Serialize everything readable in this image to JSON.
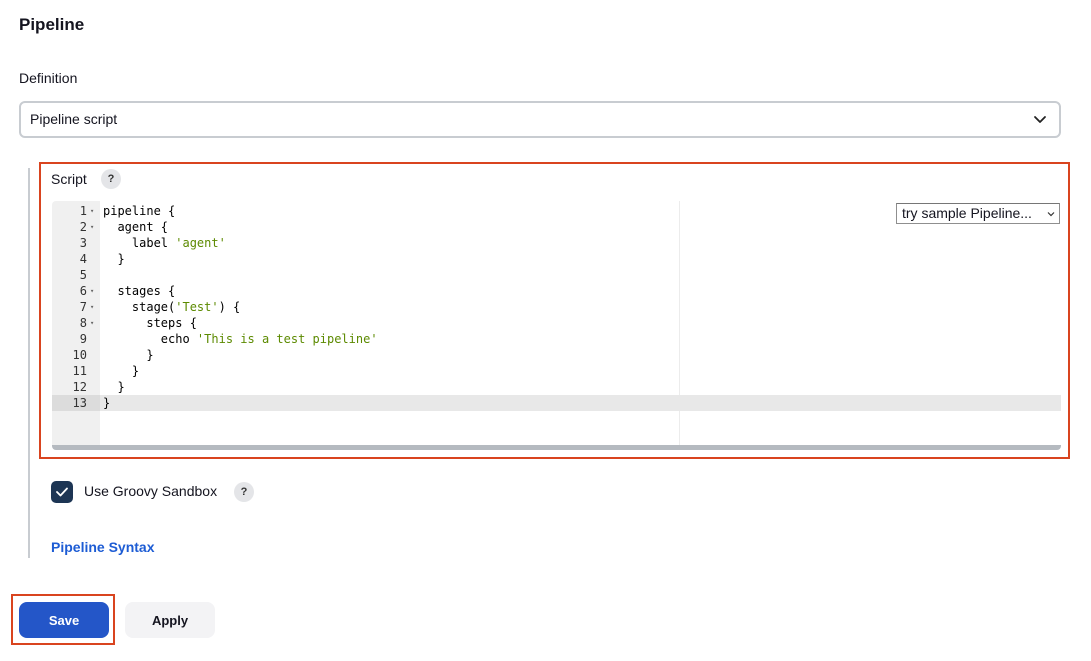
{
  "section": {
    "title": "Pipeline"
  },
  "definition": {
    "label": "Definition",
    "selected": "Pipeline script",
    "icon": "chevron-down-icon"
  },
  "script": {
    "label": "Script",
    "help": "?",
    "sample_select": "try sample Pipeline...",
    "active_line": 13,
    "lines": [
      {
        "n": "1",
        "fold": true,
        "code": "pipeline {",
        "str": ""
      },
      {
        "n": "2",
        "fold": true,
        "code": "  agent {",
        "str": ""
      },
      {
        "n": "3",
        "fold": false,
        "code": "    label ",
        "str": "'agent'"
      },
      {
        "n": "4",
        "fold": false,
        "code": "  }",
        "str": ""
      },
      {
        "n": "5",
        "fold": false,
        "code": "",
        "str": ""
      },
      {
        "n": "6",
        "fold": true,
        "code": "  stages {",
        "str": ""
      },
      {
        "n": "7",
        "fold": true,
        "code": "    stage(",
        "str": "'Test'",
        "after": ") {"
      },
      {
        "n": "8",
        "fold": true,
        "code": "      steps {",
        "str": ""
      },
      {
        "n": "9",
        "fold": false,
        "code": "        echo ",
        "str": "'This is a test pipeline'"
      },
      {
        "n": "10",
        "fold": false,
        "code": "      }",
        "str": ""
      },
      {
        "n": "11",
        "fold": false,
        "code": "    }",
        "str": ""
      },
      {
        "n": "12",
        "fold": false,
        "code": "  }",
        "str": ""
      },
      {
        "n": "13",
        "fold": false,
        "code": "}",
        "str": ""
      }
    ]
  },
  "sandbox": {
    "label": "Use Groovy Sandbox",
    "checked": true,
    "help": "?"
  },
  "syntax_link": "Pipeline Syntax",
  "buttons": {
    "save": "Save",
    "apply": "Apply"
  },
  "colors": {
    "accent": "#2456c8",
    "highlight": "#d9441f",
    "link": "#1d5cd4",
    "checkbox": "#1d3554",
    "string": "#5c8a00"
  }
}
